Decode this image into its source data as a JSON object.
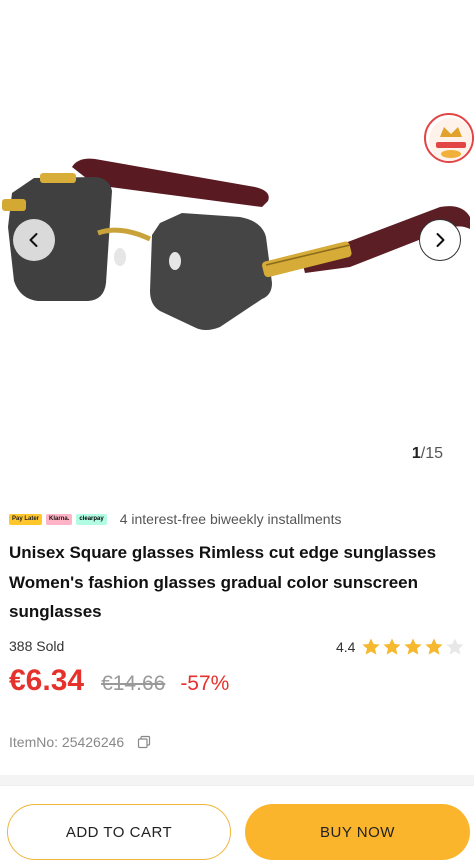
{
  "gallery": {
    "image_alt": "Rimless square sunglasses with burgundy wood-grain temples and gold hinges",
    "current": "1",
    "total": "/15",
    "prev_icon": "chevron-left-icon",
    "next_icon": "chevron-right-icon",
    "badge_icon": "vip-crown-badge-icon"
  },
  "payment": {
    "badges": [
      "Pay Later",
      "Klarna.",
      "clearpay"
    ],
    "text": "4 interest-free biweekly installments"
  },
  "product": {
    "title": "Unisex Square glasses Rimless cut edge sunglasses Women's fashion glasses gradual color sunscreen sunglasses",
    "sold": "388 Sold",
    "rating": "4.4",
    "rating_value": 4.4,
    "price": "€6.34",
    "original_price": "€14.66",
    "discount": "-57%",
    "item_no": "ItemNo: 25426246"
  },
  "actions": {
    "add_to_cart": "ADD TO CART",
    "buy_now": "BUY NOW"
  },
  "colors": {
    "price_red": "#e5322d",
    "accent_yellow": "#fab52c",
    "star_yellow": "#f5b82e"
  }
}
